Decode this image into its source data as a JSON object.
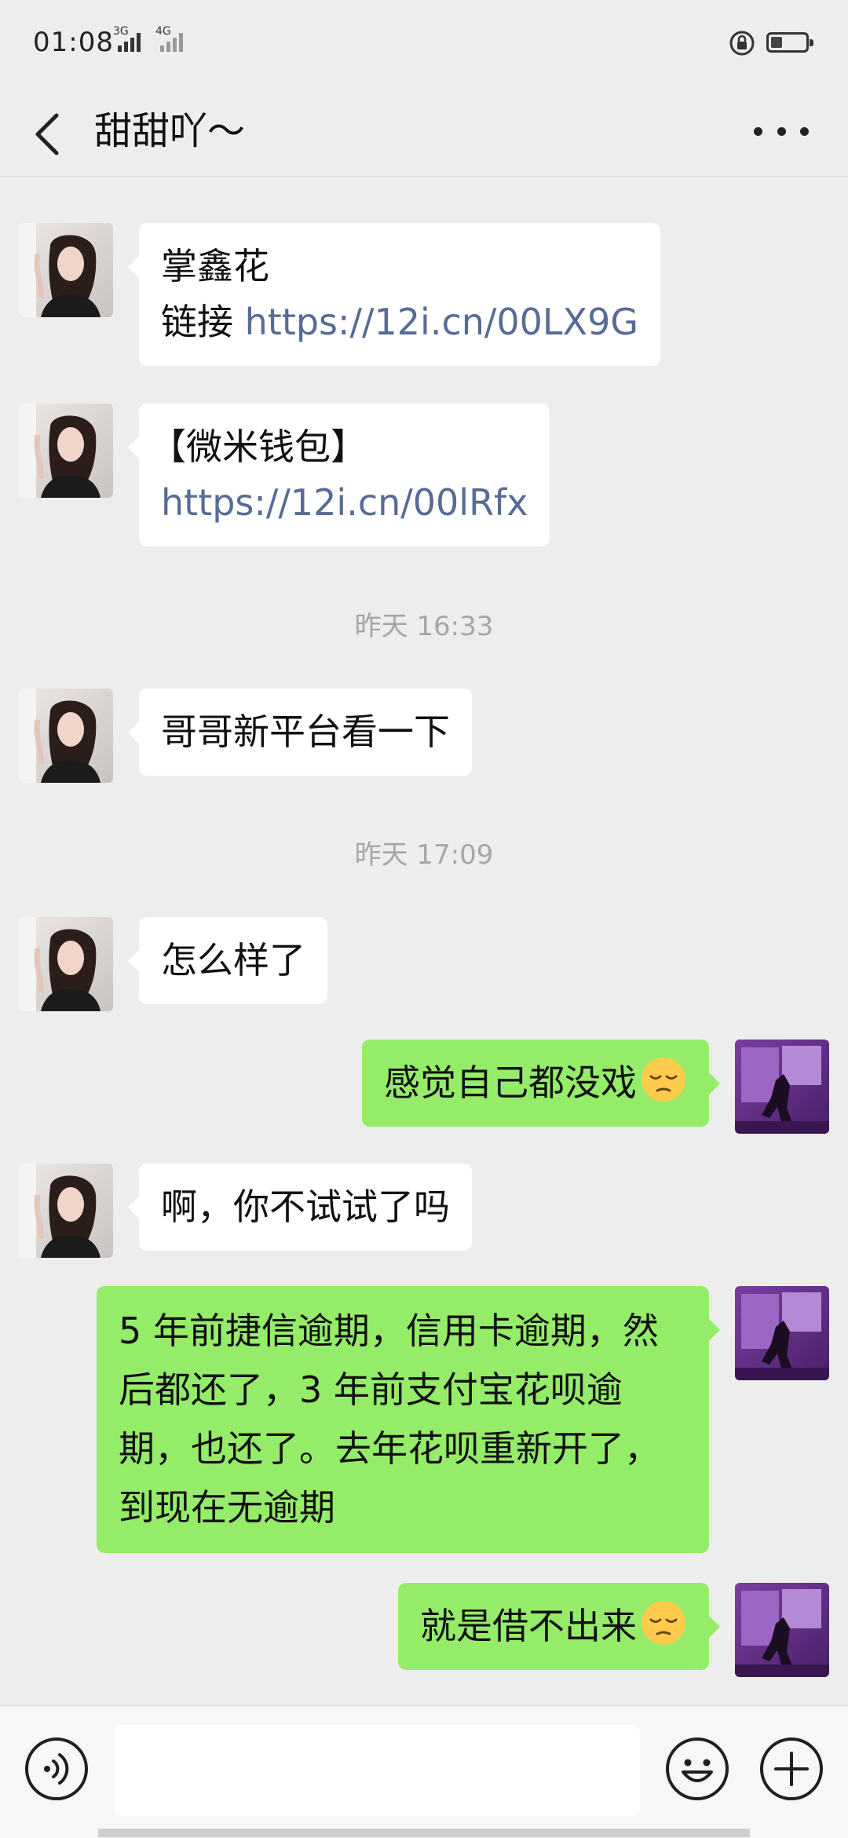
{
  "status_bar": {
    "time": "01:08",
    "network_1": "3G",
    "network_2": "4G",
    "icons": [
      "signal-icon",
      "signal-icon",
      "lock-rotation-icon",
      "battery-icon"
    ]
  },
  "header": {
    "title": "甜甜吖〜",
    "back_icon": "chevron-left-icon",
    "more_icon": "more-dots-icon"
  },
  "messages": [
    {
      "side": "in",
      "lines": [
        {
          "text": "掌鑫花"
        },
        {
          "prefix": "链接 ",
          "link": "https://12i.cn/00LX9G"
        }
      ]
    },
    {
      "side": "in",
      "lines": [
        {
          "text": "【微米钱包】"
        },
        {
          "link": "https://12i.cn/00lRfx"
        }
      ]
    },
    {
      "type": "timestamp",
      "text": "昨天 16:33"
    },
    {
      "side": "in",
      "text": "哥哥新平台看一下"
    },
    {
      "type": "timestamp",
      "text": "昨天 17:09"
    },
    {
      "side": "in",
      "text": "怎么样了"
    },
    {
      "side": "out",
      "text": "感觉自己都没戏",
      "emoji": "pensive-face-emoji"
    },
    {
      "side": "in",
      "text": "啊，你不试试了吗"
    },
    {
      "side": "out",
      "text": "5 年前捷信逾期，信用卡逾期，然后都还了，3 年前支付宝花呗逾期，也还了。去年花呗重新开了，到现在无逾期"
    },
    {
      "side": "out",
      "text": "就是借不出来",
      "emoji": "pensive-face-emoji"
    }
  ],
  "input_bar": {
    "voice_icon": "voice-icon",
    "emoji_icon": "emoji-icon",
    "plus_icon": "plus-icon",
    "text_value": ""
  },
  "colors": {
    "background": "#ededed",
    "incoming_bubble": "#ffffff",
    "outgoing_bubble": "#95ec69",
    "link": "#576b95",
    "timestamp": "#a6a6a6"
  }
}
